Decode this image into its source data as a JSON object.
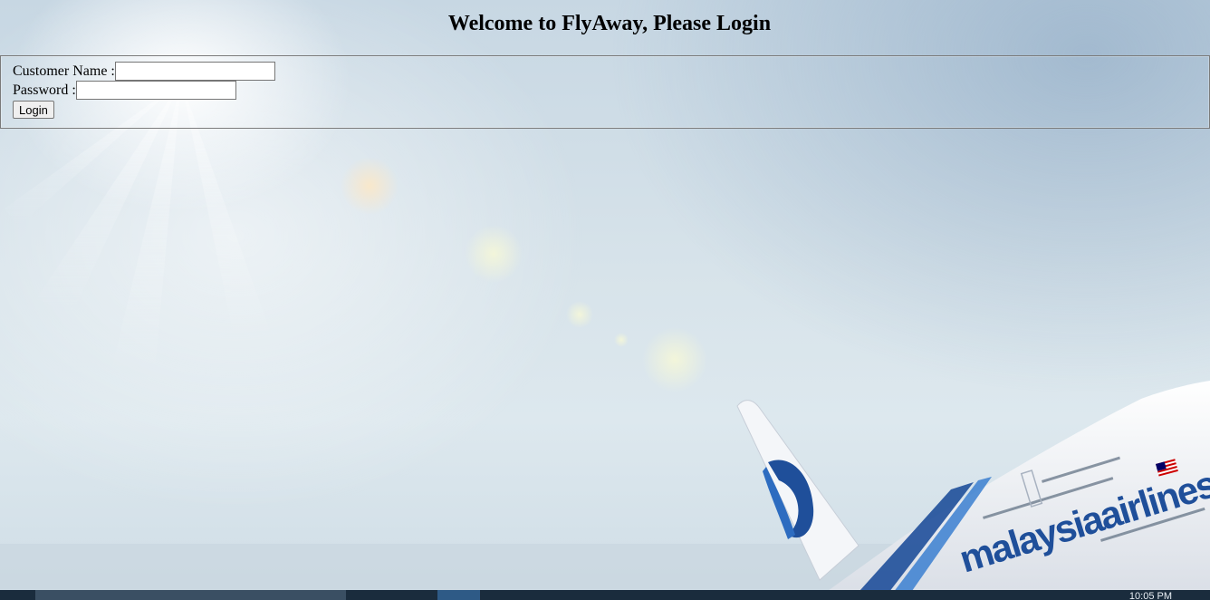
{
  "page": {
    "heading": "Welcome to FlyAway, Please Login"
  },
  "form": {
    "customer_name_label": "Customer Name :",
    "customer_name_value": "",
    "password_label": "Password :",
    "password_value": "",
    "login_button": "Login"
  },
  "background": {
    "airline_livery_text": "malaysiaairlines",
    "colors": {
      "sky": "#d7e3ea",
      "livery_blue": "#1f4f9a",
      "fuselage": "#f2f4f7"
    }
  },
  "taskbar": {
    "clock": "10:05 PM"
  }
}
